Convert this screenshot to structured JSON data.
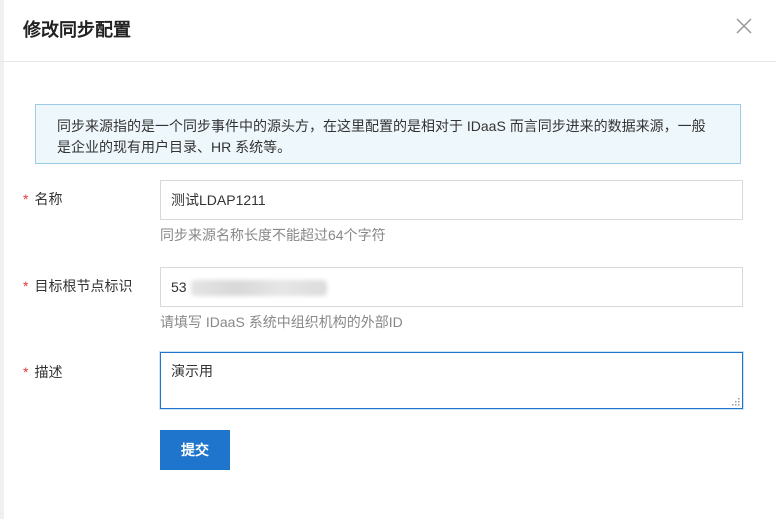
{
  "dialog": {
    "title": "修改同步配置"
  },
  "alert": {
    "text": "同步来源指的是一个同步事件中的源头方，在这里配置的是相对于 IDaaS 而言同步进来的数据来源，一般是企业的现有用户目录、HR 系统等。"
  },
  "form": {
    "name": {
      "label": "名称",
      "value": "测试LDAP1211",
      "hint": "同步来源名称长度不能超过64个字符"
    },
    "target_node": {
      "label": "目标根节点标识",
      "value_prefix": "53",
      "hint": "请填写 IDaaS 系统中组织机构的外部ID"
    },
    "description": {
      "label": "描述",
      "value": "演示用"
    },
    "required_mark": "*",
    "submit_label": "提交"
  },
  "icons": {
    "close": "close-icon",
    "resize": "resize-handle-icon"
  },
  "colors": {
    "primary": "#1f75cc",
    "required": "#e5383b",
    "alert_bg": "#eef7fc",
    "alert_border": "#9ccbe6"
  }
}
